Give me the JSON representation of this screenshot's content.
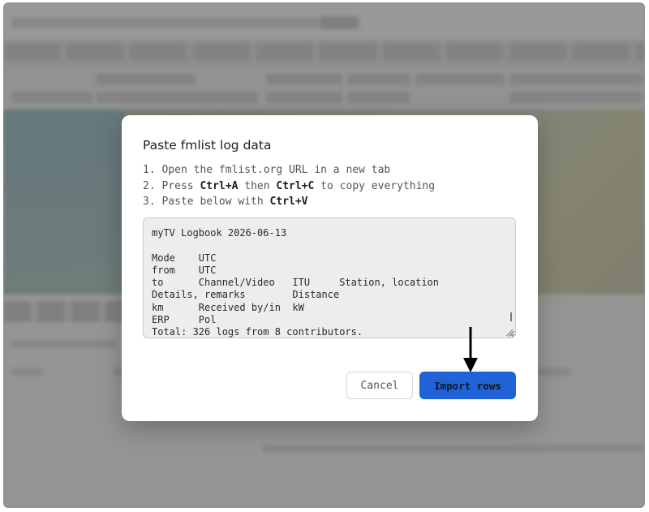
{
  "dialog": {
    "title": "Paste fmlist log data",
    "steps": [
      {
        "prefix": "1. Open the fmlist.org URL in a new tab"
      },
      {
        "prefix": "2. Press ",
        "key1": "Ctrl+A",
        "mid": " then ",
        "key2": "Ctrl+C",
        "suffix": " to copy everything"
      },
      {
        "prefix": "3. Paste below with ",
        "key1": "Ctrl+V"
      }
    ],
    "textarea_value": "myTV Logbook 2026-06-13\n\nMode    UTC\nfrom    UTC\nto      Channel/Video   ITU     Station, location\nDetails, remarks        Distance\nkm      Received by/in  kW\nERP     Pol\nTotal: 326 logs from 8 contributors.",
    "cancel_label": "Cancel",
    "import_label": "Import rows"
  },
  "colors": {
    "primary": "#1f63d6",
    "overlay": "rgba(40,40,40,0.42)",
    "textarea_bg": "#ebedef"
  },
  "icons": {
    "pointer": "down-arrow-icon",
    "resize": "resize-grip-icon"
  }
}
